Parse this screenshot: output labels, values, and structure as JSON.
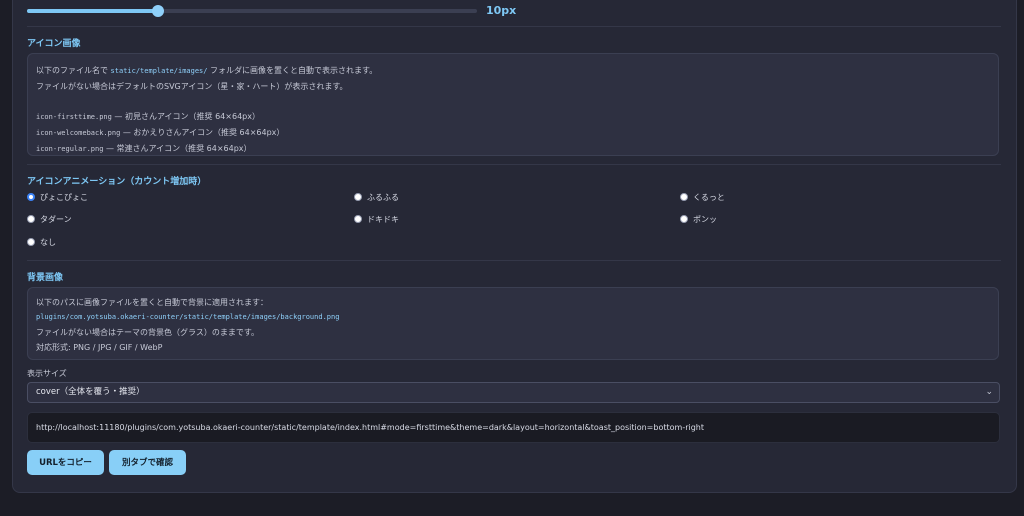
{
  "slider": {
    "value_label": "10px",
    "fraction": 0.29
  },
  "icon_section": {
    "title": "アイコン画像",
    "line1_pre": "以下のファイル名で",
    "line1_code": "static/template/images/",
    "line1_post": "フォルダに画像を置くと自動で表示されます。",
    "line2": "ファイルがない場合はデフォルトのSVGアイコン（星・家・ハート）が表示されます。",
    "files": [
      {
        "name": "icon-firsttime.png",
        "desc": "— 初見さんアイコン（推奨 64×64px）"
      },
      {
        "name": "icon-welcomeback.png",
        "desc": "— おかえりさんアイコン（推奨 64×64px）"
      },
      {
        "name": "icon-regular.png",
        "desc": "— 常連さんアイコン（推奨 64×64px）"
      }
    ]
  },
  "animation_section": {
    "title": "アイコンアニメーション（カウント増加時）",
    "options": [
      "ぴょこぴょこ",
      "ふるふる",
      "くるっと",
      "タダーン",
      "ドキドキ",
      "ポンッ",
      "なし"
    ],
    "selected": "ぴょこぴょこ"
  },
  "bg_section": {
    "title": "背景画像",
    "line1": "以下のパスに画像ファイルを置くと自動で背景に適用されます：",
    "path": "plugins/com.yotsuba.okaeri-counter/static/template/images/background.png",
    "line3": "ファイルがない場合はテーマの背景色（グラス）のままです。",
    "line4": "対応形式: PNG / JPG / GIF / WebP",
    "size_label": "表示サイズ",
    "size_value": "cover（全体を覆う・推奨）"
  },
  "url": "http://localhost:11180/plugins/com.yotsuba.okaeri-counter/static/template/index.html#mode=firsttime&theme=dark&layout=horizontal&toast_position=bottom-right",
  "buttons": {
    "copy": "URLをコピー",
    "open": "別タブで確認"
  },
  "colors": {
    "accent": "#7ec8f5",
    "button": "#88cff7",
    "panel": "#262836",
    "background": "#1c1d26"
  }
}
